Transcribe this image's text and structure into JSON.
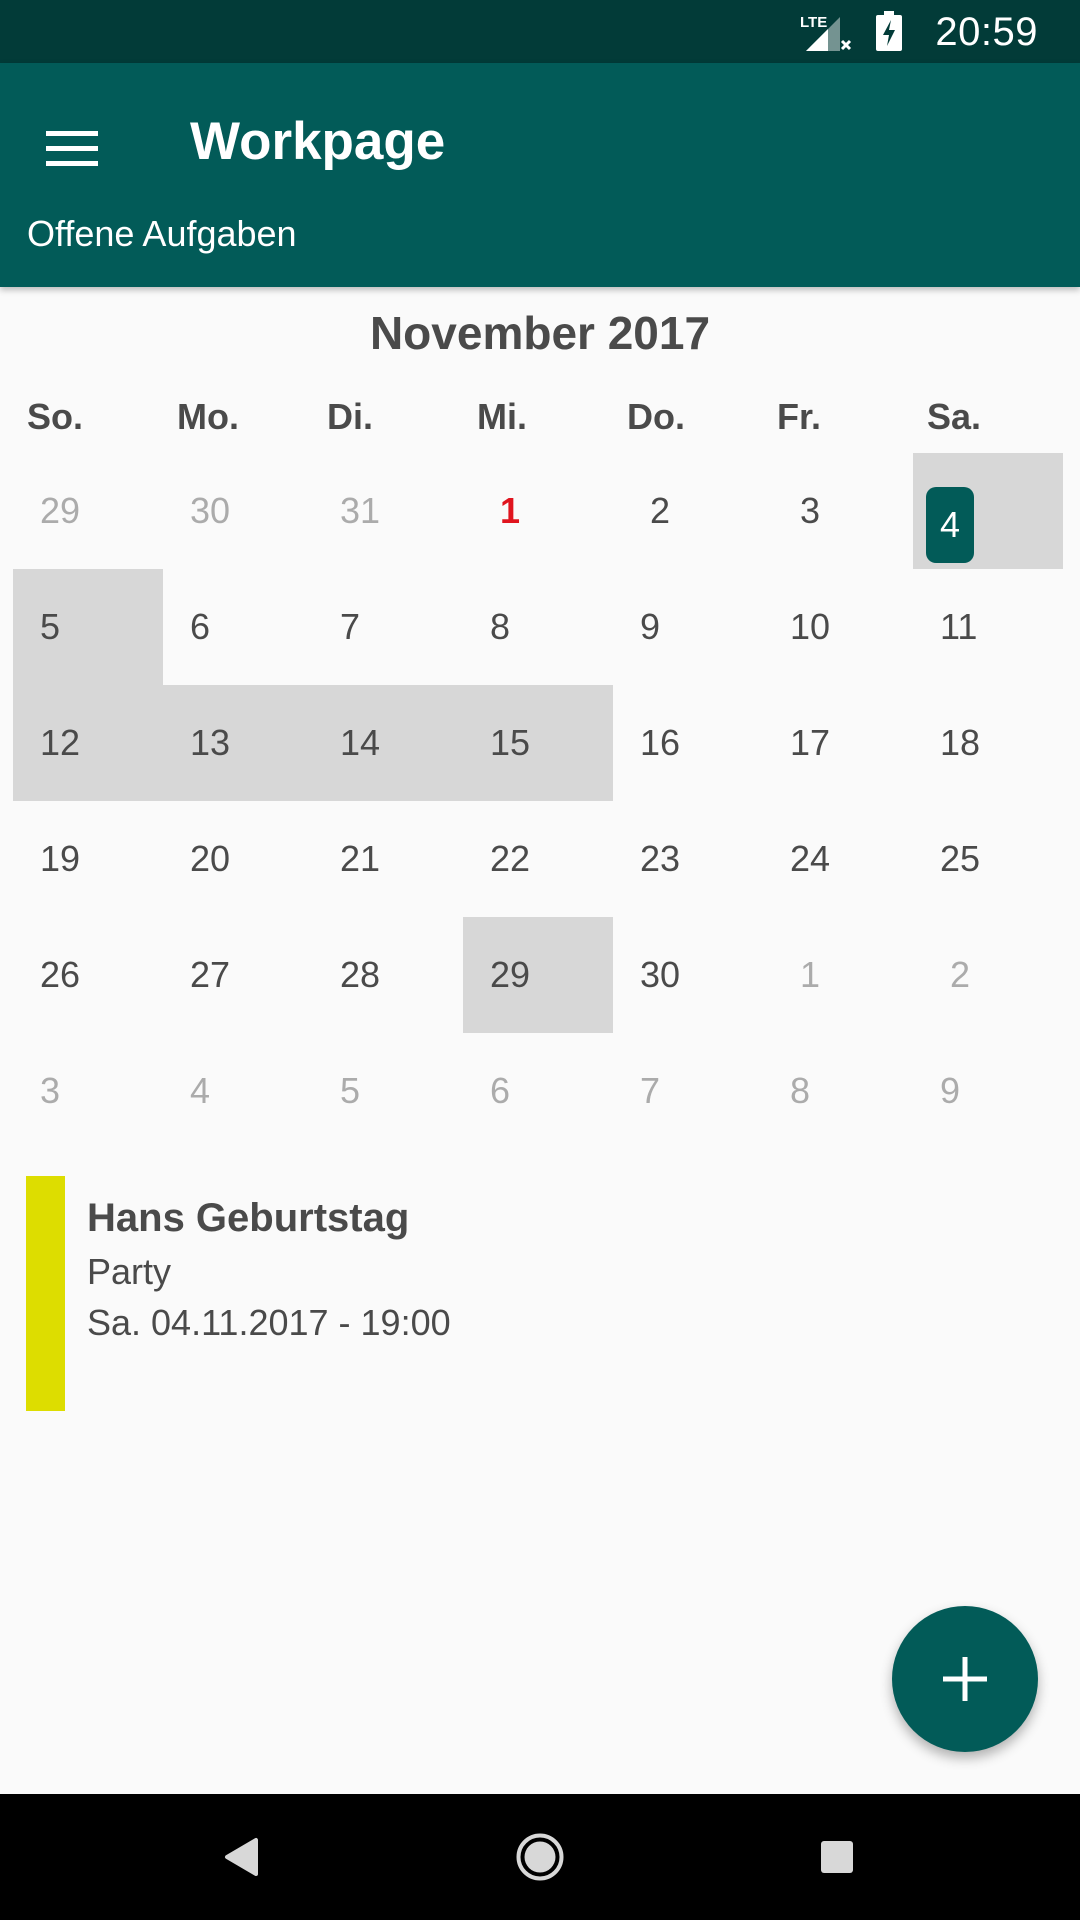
{
  "status_bar": {
    "time": "20:59",
    "network_label": "LTE",
    "icons": [
      "lte-signal-icon",
      "battery-charging-icon"
    ]
  },
  "app_bar": {
    "title": "Workpage",
    "subtitle": "Offene Aufgaben",
    "menu_icon": "menu-icon"
  },
  "calendar": {
    "month_title": "November 2017",
    "weekdays": [
      "So.",
      "Mo.",
      "Di.",
      "Mi.",
      "Do.",
      "Fr.",
      "Sa."
    ],
    "weeks": [
      [
        "29",
        "30",
        "31",
        "1",
        "2",
        "3",
        "4"
      ],
      [
        "5",
        "6",
        "7",
        "8",
        "9",
        "10",
        "11"
      ],
      [
        "12",
        "13",
        "14",
        "15",
        "16",
        "17",
        "18"
      ],
      [
        "19",
        "20",
        "21",
        "22",
        "23",
        "24",
        "25"
      ],
      [
        "26",
        "27",
        "28",
        "29",
        "30",
        "1",
        "2"
      ],
      [
        "3",
        "4",
        "5",
        "6",
        "7",
        "8",
        "9"
      ]
    ],
    "today": "1",
    "selected": "4",
    "event_days": [
      "4",
      "5",
      "12",
      "13",
      "14",
      "15",
      "29"
    ]
  },
  "event": {
    "title": "Hans Geburtstag",
    "description": "Party",
    "datetime": "Sa. 04.11.2017 - 19:00",
    "color": "#dddd00"
  },
  "fab": {
    "icon": "plus-icon"
  },
  "nav_bar": {
    "icons": [
      "back-icon",
      "home-icon",
      "recents-icon"
    ]
  },
  "colors": {
    "status_bar": "#023b38",
    "app_bar": "#025b58",
    "highlight": "#d7d7d7",
    "today": "#e0141e"
  }
}
